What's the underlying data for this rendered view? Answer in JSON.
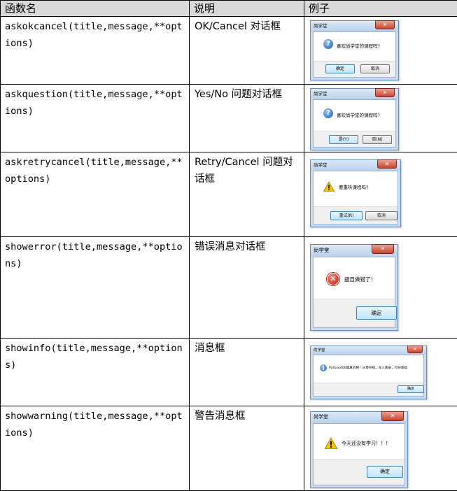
{
  "table": {
    "headers": [
      "函数名",
      "说明",
      "例子"
    ],
    "rows": [
      {
        "fn": "askokcancel(title,message,**options)",
        "desc": "OK/Cancel 对话框",
        "dialog": {
          "title": "尚学堂",
          "message": "喜欢尚学堂的课程吗?",
          "icon": "question-icon",
          "buttons": [
            "确定",
            "取消"
          ]
        }
      },
      {
        "fn": "askquestion(title,message,**options)",
        "desc": "Yes/No 问题对话框",
        "dialog": {
          "title": "尚学堂",
          "message": "喜欢尚学堂的课程吗?",
          "icon": "question-icon",
          "buttons": [
            "是(Y)",
            "否(N)"
          ]
        }
      },
      {
        "fn": "askretrycancel(title,message,**options)",
        "desc": "Retry/Cancel 问题对话框",
        "dialog": {
          "title": "尚学堂",
          "message": "要重听课程吗?",
          "icon": "warning-icon",
          "buttons": [
            "重试(R)",
            "取消"
          ]
        }
      },
      {
        "fn": "showerror(title,message,**options)",
        "desc": "错误消息对话框",
        "dialog": {
          "title": "尚学堂",
          "message": "题目做错了！",
          "icon": "error-icon",
          "buttons": [
            "确定"
          ]
        }
      },
      {
        "fn": "showinfo(title,message,**options)",
        "desc": "消息框",
        "dialog": {
          "title": "尚学堂",
          "message": "Python400集真的棒！从零开始，深入底层，打好基础",
          "icon": "info-icon",
          "buttons": [
            "确定"
          ]
        }
      },
      {
        "fn": "showwarning(title,message,**options)",
        "desc": "警告消息框",
        "dialog": {
          "title": "尚学堂",
          "message": "今天还没有学习！！！",
          "icon": "warning-icon",
          "buttons": [
            "确定"
          ]
        }
      }
    ]
  }
}
